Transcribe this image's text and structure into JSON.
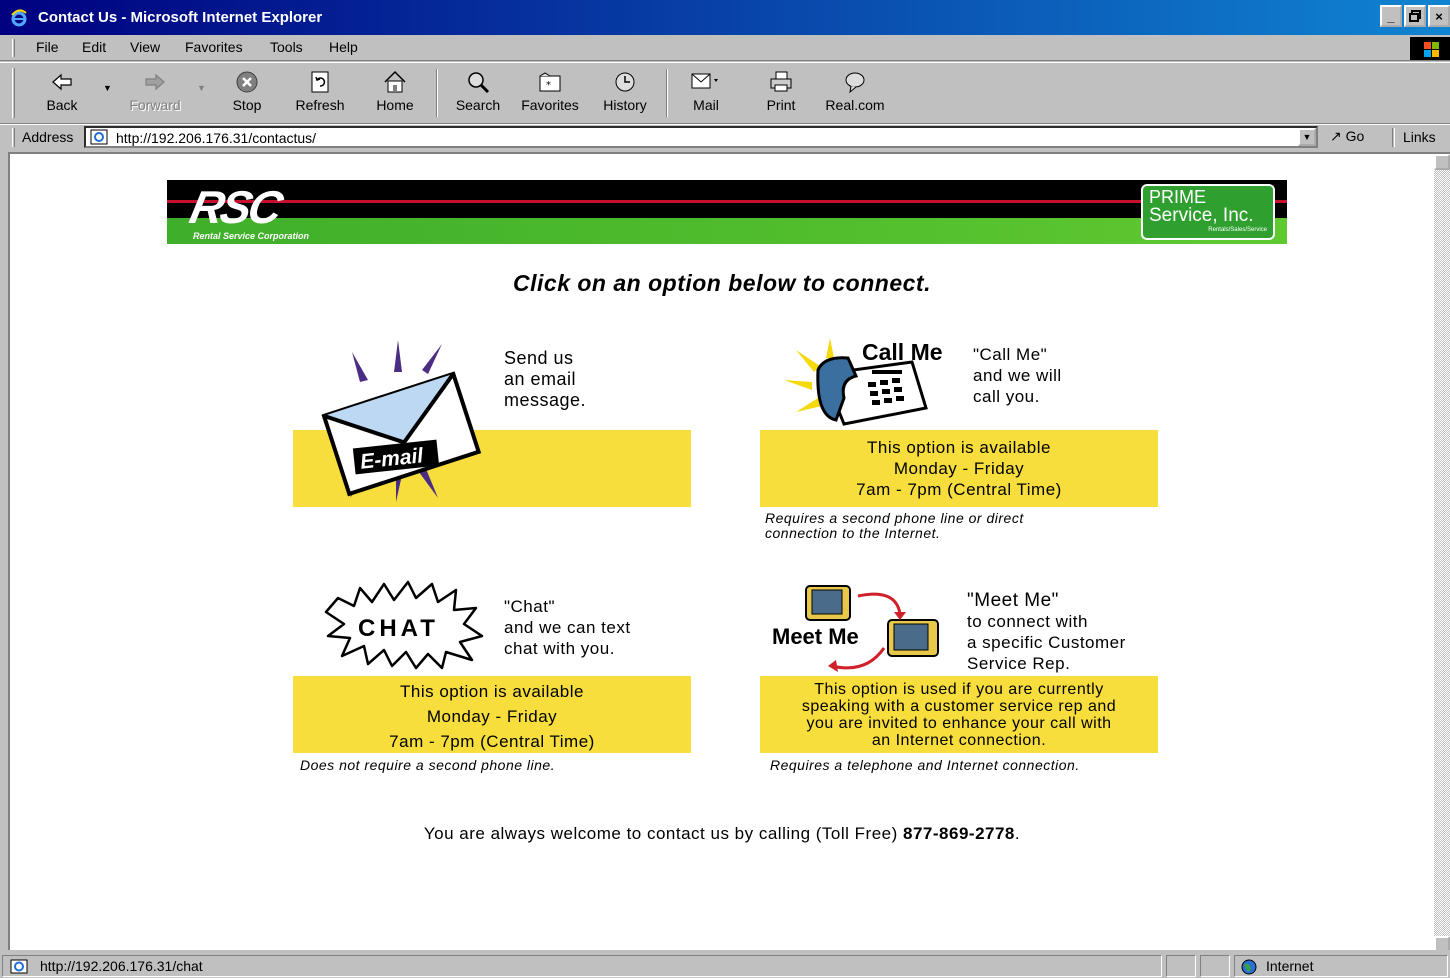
{
  "window": {
    "title": "Contact Us - Microsoft Internet Explorer",
    "buttons": [
      "_",
      "×"
    ]
  },
  "menu": [
    "File",
    "Edit",
    "View",
    "Favorites",
    "Tools",
    "Help"
  ],
  "toolbar": {
    "back": "Back",
    "forward": "Forward",
    "stop": "Stop",
    "refresh": "Refresh",
    "home": "Home",
    "search": "Search",
    "favorites": "Favorites",
    "history": "History",
    "mail": "Mail",
    "print": "Print",
    "realcom": "Real.com"
  },
  "address": {
    "label": "Address",
    "url": "http://192.206.176.31/contactus/",
    "go": "Go",
    "links": "Links"
  },
  "banner": {
    "logo": "RSC",
    "logo_sub": "Rental Service Corporation",
    "prime_line1": "PRIME",
    "prime_line2": "Service, Inc.",
    "prime_line3": "Rentals/Sales/Service"
  },
  "page": {
    "headline": "Click on an option below to connect.",
    "email": {
      "icon_label": "E-mail",
      "desc": [
        "Send us",
        "an email",
        "message."
      ]
    },
    "callme": {
      "icon_label": "Call Me",
      "desc": [
        "\"Call Me\"",
        "and we will",
        "call you."
      ],
      "box": [
        "This option is available",
        "Monday - Friday",
        "7am - 7pm (Central Time)"
      ],
      "note": [
        "Requires a second phone line or direct",
        "connection to the Internet."
      ]
    },
    "chat": {
      "icon_label": "CHAT",
      "desc": [
        "\"Chat\"",
        "and we can text",
        "chat with you."
      ],
      "box": [
        "This option is available",
        "Monday - Friday",
        "7am - 7pm (Central Time)"
      ],
      "note": "Does not require a second phone line."
    },
    "meetme": {
      "icon_label": "Meet Me",
      "desc": [
        "\"Meet Me\"",
        "to connect with",
        "a specific Customer",
        "Service Rep."
      ],
      "box": [
        "This option is used if you are currently",
        "speaking with a customer service rep and",
        "you are invited to enhance your call with",
        "an Internet connection."
      ],
      "note": "Requires a telephone and Internet connection."
    },
    "footer_prefix": "You are always welcome to contact us by calling (Toll Free) ",
    "footer_phone": "877-869-2778",
    "footer_suffix": "."
  },
  "status": {
    "url": "http://192.206.176.31/chat",
    "zone": "Internet"
  },
  "colors": {
    "titlebar": "#000080",
    "yellow_box": "#f7de3d",
    "banner_green": "#3fae2a",
    "banner_red": "#c8102e"
  }
}
